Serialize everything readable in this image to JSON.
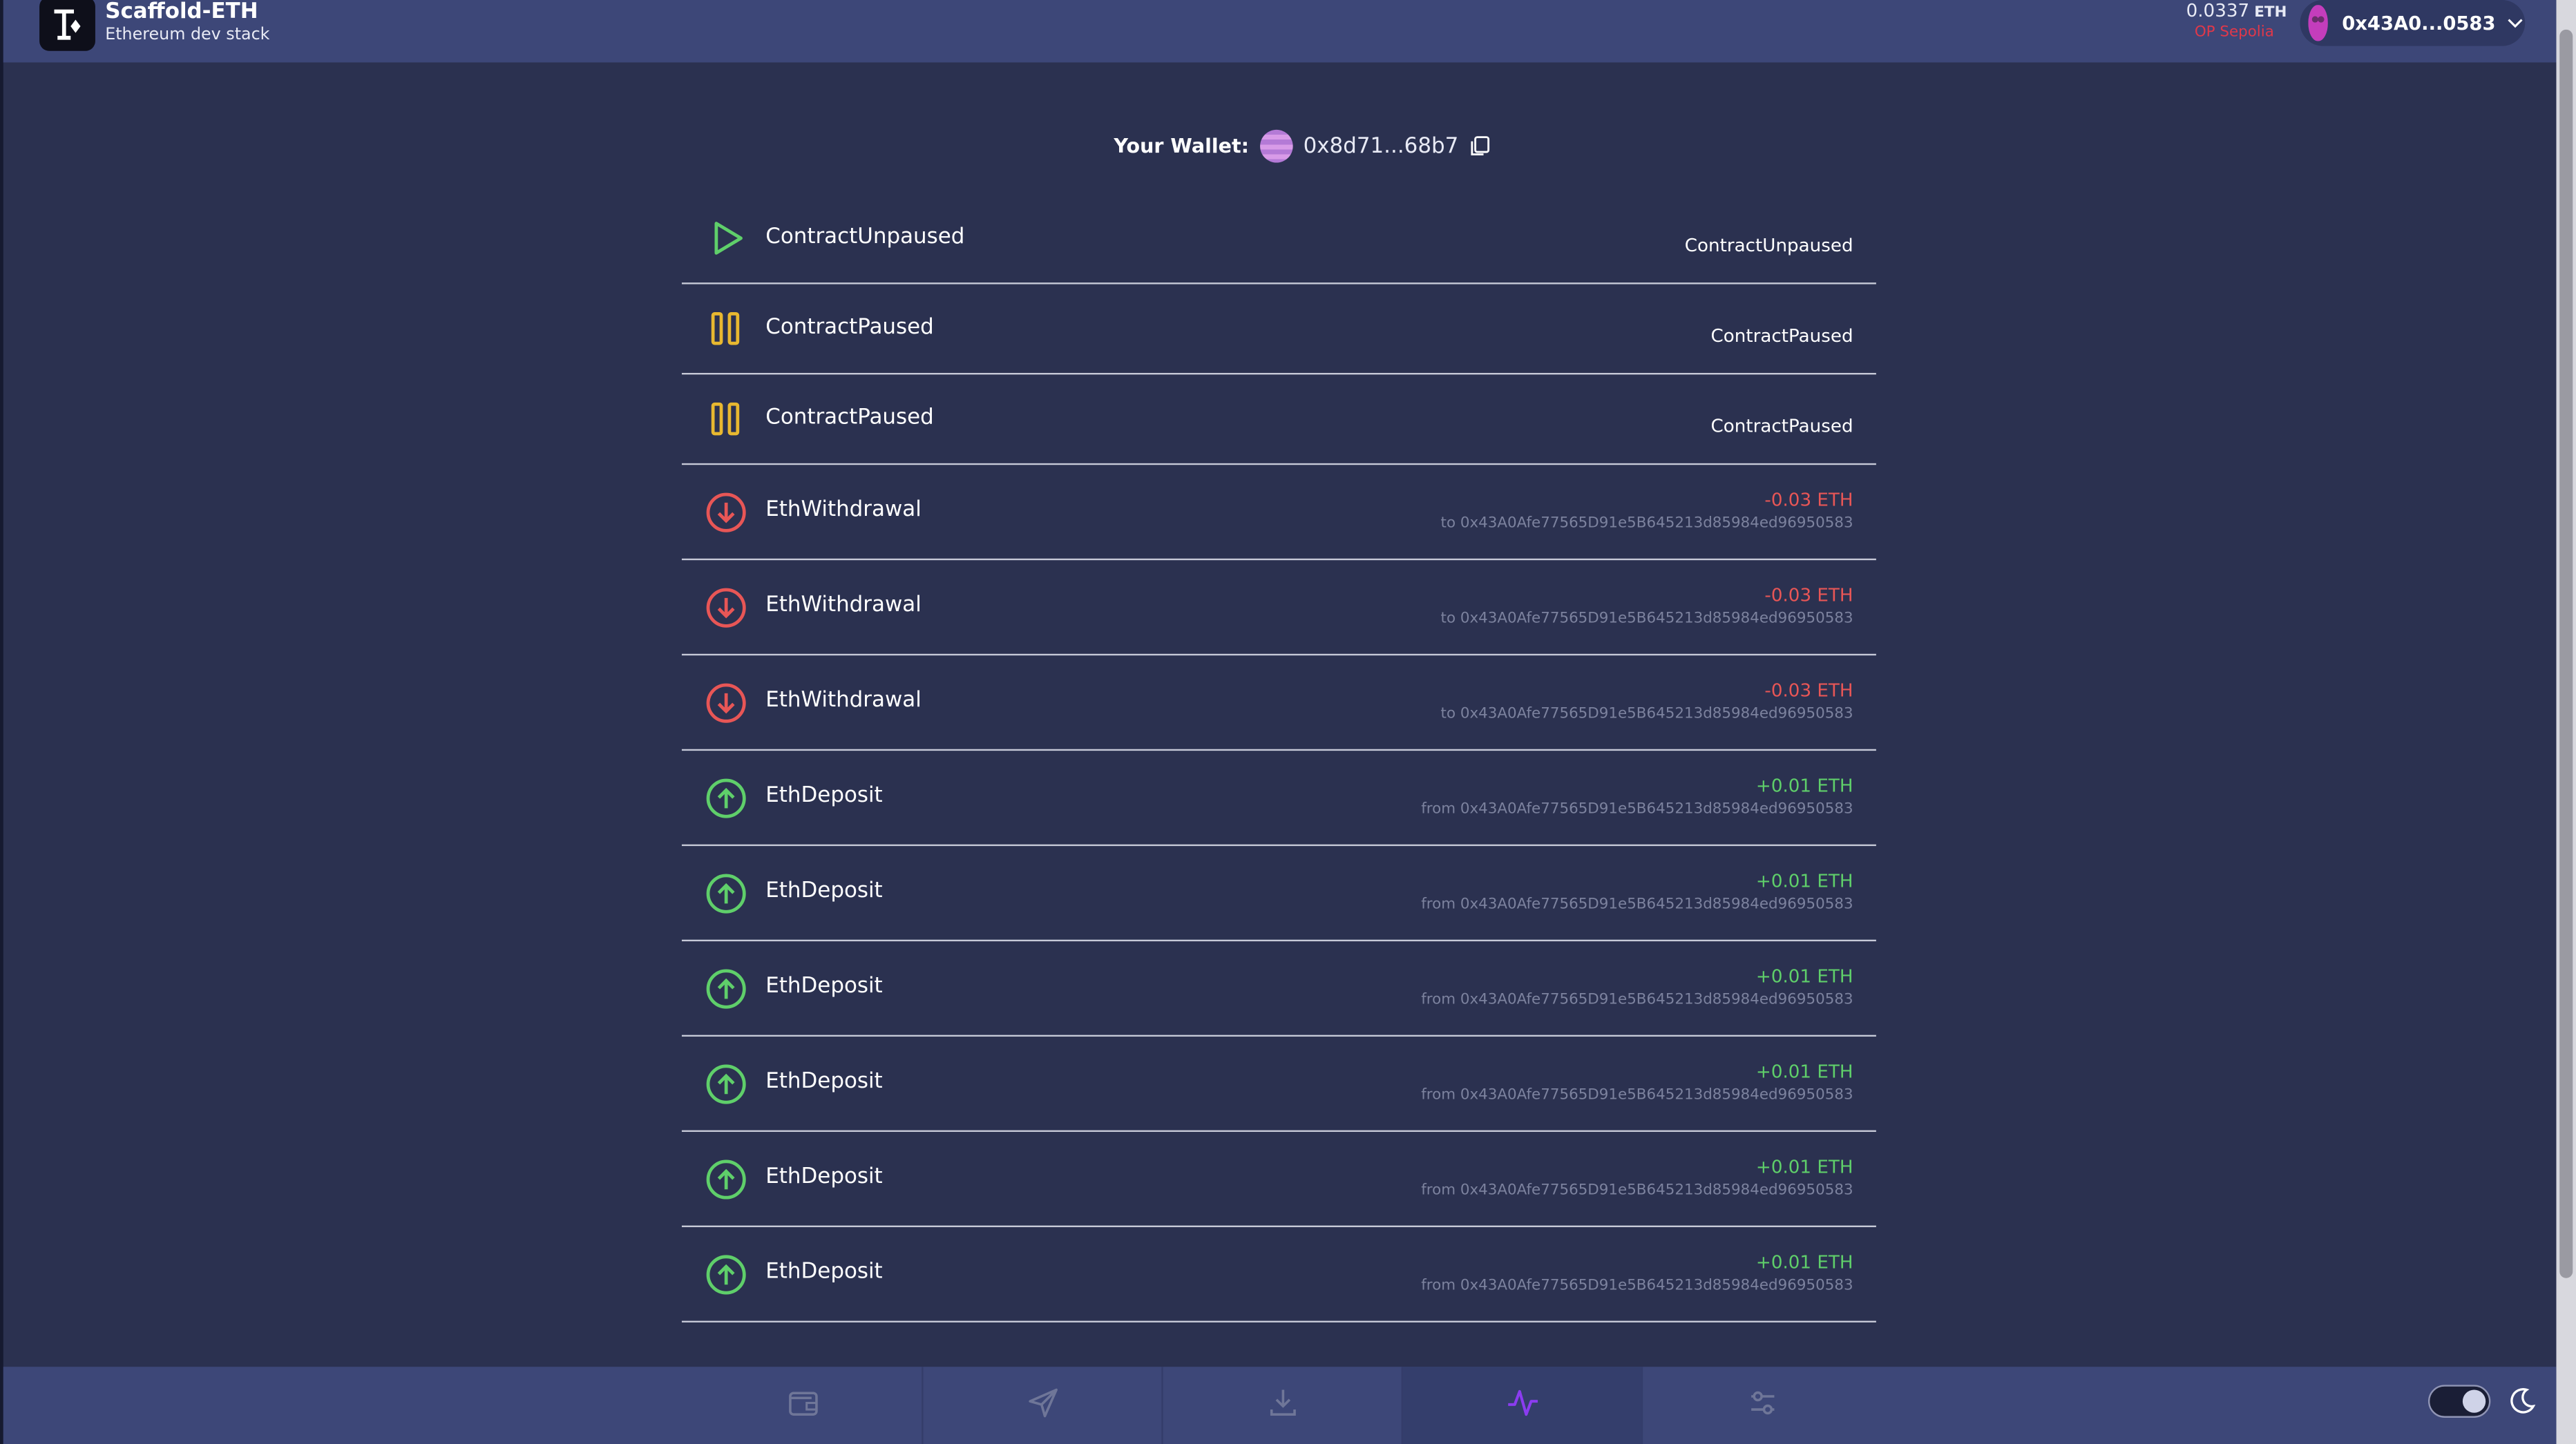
{
  "header": {
    "brand_title": "Scaffold-ETH",
    "brand_subtitle": "Ethereum dev stack",
    "balance_value": "0.0337",
    "balance_unit": "ETH",
    "network": "OP Sepolia",
    "account_address": "0x43A0...0583"
  },
  "wallet": {
    "label": "Your Wallet:",
    "address": "0x8d71...68b7"
  },
  "events": [
    {
      "name": "ContractUnpaused",
      "type": "unpaused",
      "value": "ContractUnpaused"
    },
    {
      "name": "ContractPaused",
      "type": "paused",
      "value": "ContractPaused"
    },
    {
      "name": "ContractPaused",
      "type": "paused",
      "value": "ContractPaused"
    },
    {
      "name": "EthWithdrawal",
      "type": "withdrawal",
      "value": "-0.03 ETH",
      "address": "to 0x43A0Afe77565D91e5B645213d85984ed96950583"
    },
    {
      "name": "EthWithdrawal",
      "type": "withdrawal",
      "value": "-0.03 ETH",
      "address": "to 0x43A0Afe77565D91e5B645213d85984ed96950583"
    },
    {
      "name": "EthWithdrawal",
      "type": "withdrawal",
      "value": "-0.03 ETH",
      "address": "to 0x43A0Afe77565D91e5B645213d85984ed96950583"
    },
    {
      "name": "EthDeposit",
      "type": "deposit",
      "value": "+0.01 ETH",
      "address": "from 0x43A0Afe77565D91e5B645213d85984ed96950583"
    },
    {
      "name": "EthDeposit",
      "type": "deposit",
      "value": "+0.01 ETH",
      "address": "from 0x43A0Afe77565D91e5B645213d85984ed96950583"
    },
    {
      "name": "EthDeposit",
      "type": "deposit",
      "value": "+0.01 ETH",
      "address": "from 0x43A0Afe77565D91e5B645213d85984ed96950583"
    },
    {
      "name": "EthDeposit",
      "type": "deposit",
      "value": "+0.01 ETH",
      "address": "from 0x43A0Afe77565D91e5B645213d85984ed96950583"
    },
    {
      "name": "EthDeposit",
      "type": "deposit",
      "value": "+0.01 ETH",
      "address": "from 0x43A0Afe77565D91e5B645213d85984ed96950583"
    },
    {
      "name": "EthDeposit",
      "type": "deposit",
      "value": "+0.01 ETH",
      "address": "from 0x43A0Afe77565D91e5B645213d85984ed96950583"
    }
  ],
  "colors": {
    "deposit": "#5fcf6a",
    "withdrawal": "#e85656",
    "paused": "#e8b830",
    "unpaused": "#5fcf6a",
    "active_tab": "#8b3cf0"
  },
  "footer": {
    "tabs": [
      {
        "icon": "wallet-icon",
        "active": false
      },
      {
        "icon": "send-icon",
        "active": false
      },
      {
        "icon": "download-icon",
        "active": false
      },
      {
        "icon": "activity-icon",
        "active": true
      },
      {
        "icon": "settings-sliders-icon",
        "active": false
      }
    ],
    "theme": "dark"
  }
}
